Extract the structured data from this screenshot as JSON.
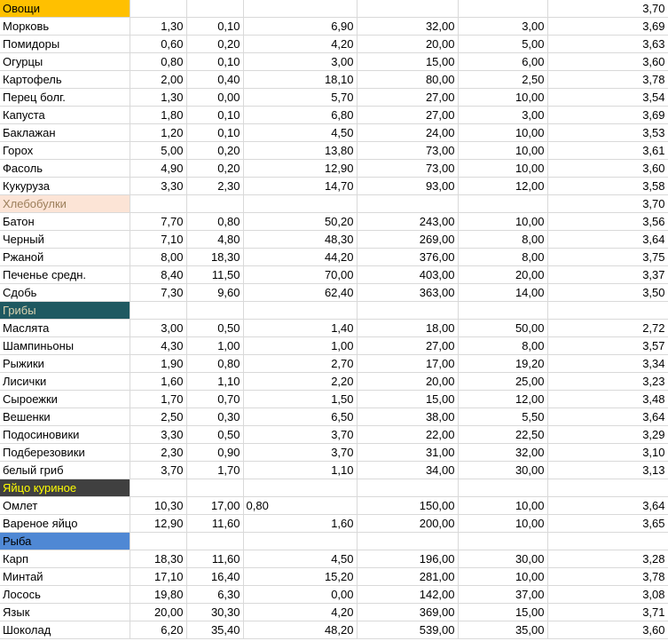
{
  "colors": {
    "ovoshchi": "#ffc000",
    "khleb": "#fce4d6",
    "griby": "#1f5961",
    "yaytso": "#404040",
    "ryba": "#4f88d4"
  },
  "sections": [
    {
      "key": "ovoshchi",
      "title": "Овощи",
      "title_color": "#000000",
      "header_last": "3,70",
      "rows": [
        {
          "name": "Морковь",
          "c": [
            "1,30",
            "0,10",
            "6,90",
            "32,00",
            "3,00",
            "3,69"
          ]
        },
        {
          "name": "Помидоры",
          "c": [
            "0,60",
            "0,20",
            "4,20",
            "20,00",
            "5,00",
            "3,63"
          ]
        },
        {
          "name": "Огурцы",
          "c": [
            "0,80",
            "0,10",
            "3,00",
            "15,00",
            "6,00",
            "3,60"
          ]
        },
        {
          "name": "Картофель",
          "c": [
            "2,00",
            "0,40",
            "18,10",
            "80,00",
            "2,50",
            "3,78"
          ]
        },
        {
          "name": "Перец болг.",
          "c": [
            "1,30",
            "0,00",
            "5,70",
            "27,00",
            "10,00",
            "3,54"
          ]
        },
        {
          "name": "Капуста",
          "c": [
            "1,80",
            "0,10",
            "6,80",
            "27,00",
            "3,00",
            "3,69"
          ]
        },
        {
          "name": "Баклажан",
          "c": [
            "1,20",
            "0,10",
            "4,50",
            "24,00",
            "10,00",
            "3,53"
          ]
        },
        {
          "name": "Горох",
          "c": [
            "5,00",
            "0,20",
            "13,80",
            "73,00",
            "10,00",
            "3,61"
          ]
        },
        {
          "name": "Фасоль",
          "c": [
            "4,90",
            "0,20",
            "12,90",
            "73,00",
            "10,00",
            "3,60"
          ]
        },
        {
          "name": "Кукуруза",
          "c": [
            "3,30",
            "2,30",
            "14,70",
            "93,00",
            "12,00",
            "3,58"
          ]
        }
      ]
    },
    {
      "key": "khleb",
      "title": "Хлебобулки",
      "title_color": "#9c7f5b",
      "header_last": "3,70",
      "rows": [
        {
          "name": "Батон",
          "c": [
            "7,70",
            "0,80",
            "50,20",
            "243,00",
            "10,00",
            "3,56"
          ]
        },
        {
          "name": "Черный",
          "c": [
            "7,10",
            "4,80",
            "48,30",
            "269,00",
            "8,00",
            "3,64"
          ]
        },
        {
          "name": "Ржаной",
          "c": [
            "8,00",
            "18,30",
            "44,20",
            "376,00",
            "8,00",
            "3,75"
          ]
        },
        {
          "name": "Печенье средн.",
          "c": [
            "8,40",
            "11,50",
            "70,00",
            "403,00",
            "20,00",
            "3,37"
          ]
        },
        {
          "name": "Сдобь",
          "c": [
            "7,30",
            "9,60",
            "62,40",
            "363,00",
            "14,00",
            "3,50"
          ]
        }
      ]
    },
    {
      "key": "griby",
      "title": "Грибы",
      "title_color": "#d9d2b0",
      "header_last": "",
      "rows": [
        {
          "name": "Маслята",
          "c": [
            "3,00",
            "0,50",
            "1,40",
            "18,00",
            "50,00",
            "2,72"
          ]
        },
        {
          "name": "Шампиньоны",
          "c": [
            "4,30",
            "1,00",
            "1,00",
            "27,00",
            "8,00",
            "3,57"
          ]
        },
        {
          "name": "Рыжики",
          "c": [
            "1,90",
            "0,80",
            "2,70",
            "17,00",
            "19,20",
            "3,34"
          ]
        },
        {
          "name": "Лисички",
          "c": [
            "1,60",
            "1,10",
            "2,20",
            "20,00",
            "25,00",
            "3,23"
          ]
        },
        {
          "name": "Сыроежки",
          "c": [
            "1,70",
            "0,70",
            "1,50",
            "15,00",
            "12,00",
            "3,48"
          ]
        },
        {
          "name": "Вешенки",
          "c": [
            "2,50",
            "0,30",
            "6,50",
            "38,00",
            "5,50",
            "3,64"
          ]
        },
        {
          "name": "Подосиновики",
          "c": [
            "3,30",
            "0,50",
            "3,70",
            "22,00",
            "22,50",
            "3,29"
          ]
        },
        {
          "name": "Подберезовики",
          "c": [
            "2,30",
            "0,90",
            "3,70",
            "31,00",
            "32,00",
            "3,10"
          ]
        },
        {
          "name": "белый гриб",
          "c": [
            "3,70",
            "1,70",
            "1,10",
            "34,00",
            "30,00",
            "3,13"
          ]
        }
      ]
    },
    {
      "key": "yaytso",
      "title": "Яйцо куриное",
      "title_color": "#ffff00",
      "header_last": "",
      "rows": [
        {
          "name": "Омлет",
          "c": [
            "10,30",
            "17,00",
            "0,80",
            "150,00",
            "10,00",
            "3,64"
          ],
          "left3": true
        },
        {
          "name": "Вареное яйцо",
          "c": [
            "12,90",
            "11,60",
            "1,60",
            "200,00",
            "10,00",
            "3,65"
          ]
        }
      ]
    },
    {
      "key": "ryba",
      "title": "Рыба",
      "title_color": "#000000",
      "header_last": "",
      "rows": [
        {
          "name": "Карп",
          "c": [
            "18,30",
            "11,60",
            "4,50",
            "196,00",
            "30,00",
            "3,28"
          ]
        },
        {
          "name": "Минтай",
          "c": [
            "17,10",
            "16,40",
            "15,20",
            "281,00",
            "10,00",
            "3,78"
          ]
        },
        {
          "name": "Лосось",
          "c": [
            "19,80",
            "6,30",
            "0,00",
            "142,00",
            "37,00",
            "3,08"
          ]
        },
        {
          "name": "Язык",
          "c": [
            "20,00",
            "30,30",
            "4,20",
            "369,00",
            "15,00",
            "3,71"
          ]
        },
        {
          "name": "Шоколад",
          "c": [
            "6,20",
            "35,40",
            "48,20",
            "539,00",
            "35,00",
            "3,60"
          ]
        }
      ]
    }
  ]
}
